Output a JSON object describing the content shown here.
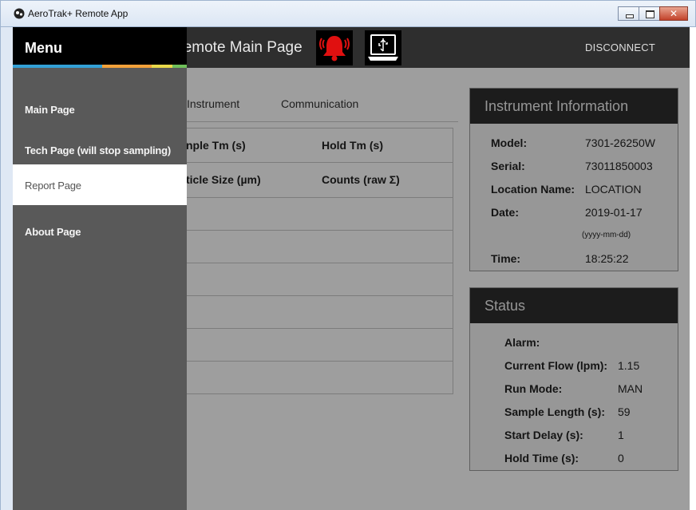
{
  "window": {
    "title": "AeroTrak+ Remote App"
  },
  "header": {
    "page_title": "Remote Main Page",
    "disconnect_label": "DISCONNECT"
  },
  "menu": {
    "title": "Menu",
    "items": [
      {
        "label": "Main Page"
      },
      {
        "label": "Tech Page (will stop sampling)"
      },
      {
        "label": "Report Page"
      },
      {
        "label": "About Page"
      }
    ],
    "active_index": 2
  },
  "tabs": [
    {
      "label": "Instrument"
    },
    {
      "label": "Communication"
    }
  ],
  "grid": {
    "row1": {
      "col1": "nple Tm (s)",
      "col2": "Hold Tm (s)"
    },
    "row2": {
      "col1": "ticle Size (µm)",
      "col2": "Counts (raw Σ)"
    },
    "empty_rows": 6
  },
  "instrument_info": {
    "title": "Instrument Information",
    "model_label": "Model:",
    "model": "7301-26250W",
    "serial_label": "Serial:",
    "serial": "73011850003",
    "location_label": "Location Name:",
    "location": "LOCATION",
    "date_label": "Date:",
    "date": "2019-01-17",
    "date_format": "(yyyy-mm-dd)",
    "time_label": "Time:",
    "time": "18:25:22"
  },
  "status": {
    "title": "Status",
    "alarm_label": "Alarm:",
    "alarm": "",
    "flow_label": "Current Flow (lpm):",
    "flow": "1.15",
    "run_mode_label": "Run Mode:",
    "run_mode": "MAN",
    "sample_length_label": "Sample Length (s):",
    "sample_length": "59",
    "start_delay_label": "Start Delay (s):",
    "start_delay": "1",
    "hold_time_label": "Hold Time (s):",
    "hold_time": "0"
  },
  "colors": {
    "alarm_bell": "#e01010",
    "header_bg": "#2e2e2e",
    "menu_bg": "#595959"
  }
}
